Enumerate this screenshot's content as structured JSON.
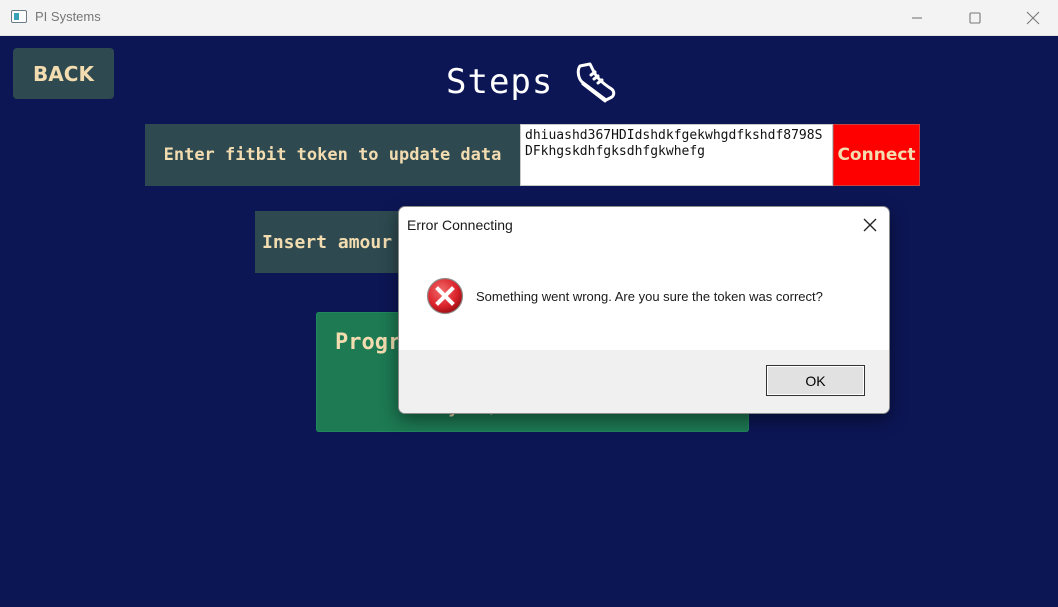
{
  "window": {
    "title": "PI Systems",
    "icon": "app-window-icon"
  },
  "header": {
    "back_label": "BACK",
    "page_title": "Steps",
    "title_icon": "running-shoe-icon"
  },
  "token_section": {
    "label": "Enter fitbit token to update data",
    "value": "dhiuashd367HDIdshdkfgekwhgdfkshdf8798SDFkhgskdhfgksdhfgkwhefg",
    "connect_label": "Connect",
    "connect_color": "#ff0000"
  },
  "amount_section": {
    "label": "Insert amour"
  },
  "progress_card": {
    "title": "Progr",
    "day_text": "Day: 0/7"
  },
  "dialog": {
    "title": "Error Connecting",
    "icon": "error-icon",
    "message": "Something went wrong. Are you sure the token was correct?",
    "ok_label": "OK"
  },
  "colors": {
    "background": "#0c1655",
    "panel": "#2e4a50",
    "label_text": "#f2dcb0",
    "progress": "#1d7a53",
    "error": "#d9232a"
  }
}
